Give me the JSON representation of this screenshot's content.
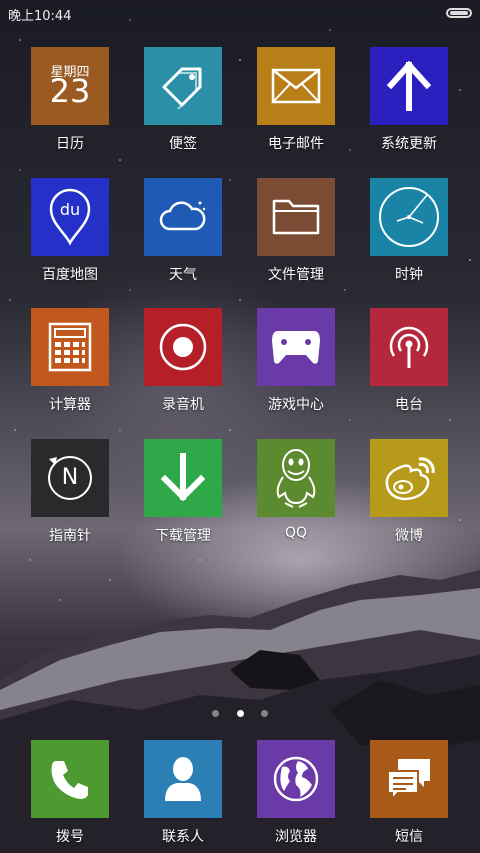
{
  "status": {
    "time": "晚上10:44"
  },
  "calendar_tile": {
    "weekday": "星期四",
    "day": "23"
  },
  "apps": [
    {
      "label": "日历",
      "color": "#9a5a22"
    },
    {
      "label": "便签",
      "color": "#2b8fa8"
    },
    {
      "label": "电子邮件",
      "color": "#b87e18"
    },
    {
      "label": "系统更新",
      "color": "#2c1fc0"
    },
    {
      "label": "百度地图",
      "color": "#2430c8"
    },
    {
      "label": "天气",
      "color": "#1f5bb4"
    },
    {
      "label": "文件管理",
      "color": "#7b4b34"
    },
    {
      "label": "时钟",
      "color": "#1a84a6"
    },
    {
      "label": "计算器",
      "color": "#c0581e"
    },
    {
      "label": "录音机",
      "color": "#b52028"
    },
    {
      "label": "游戏中心",
      "color": "#6a3aa8"
    },
    {
      "label": "电台",
      "color": "#b5283c"
    },
    {
      "label": "指南针",
      "color": "#2a2a2c"
    },
    {
      "label": "下载管理",
      "color": "#2fa84a"
    },
    {
      "label": "QQ",
      "color": "#5c8a2e"
    },
    {
      "label": "微博",
      "color": "#b89a1a"
    }
  ],
  "dock": [
    {
      "label": "拨号",
      "color": "#4c9a30"
    },
    {
      "label": "联系人",
      "color": "#2b7fb5"
    },
    {
      "label": "浏览器",
      "color": "#6a3aa8"
    },
    {
      "label": "短信",
      "color": "#a85a18"
    }
  ],
  "compass_letter": "N",
  "pager": {
    "pages": 3,
    "active": 2
  }
}
